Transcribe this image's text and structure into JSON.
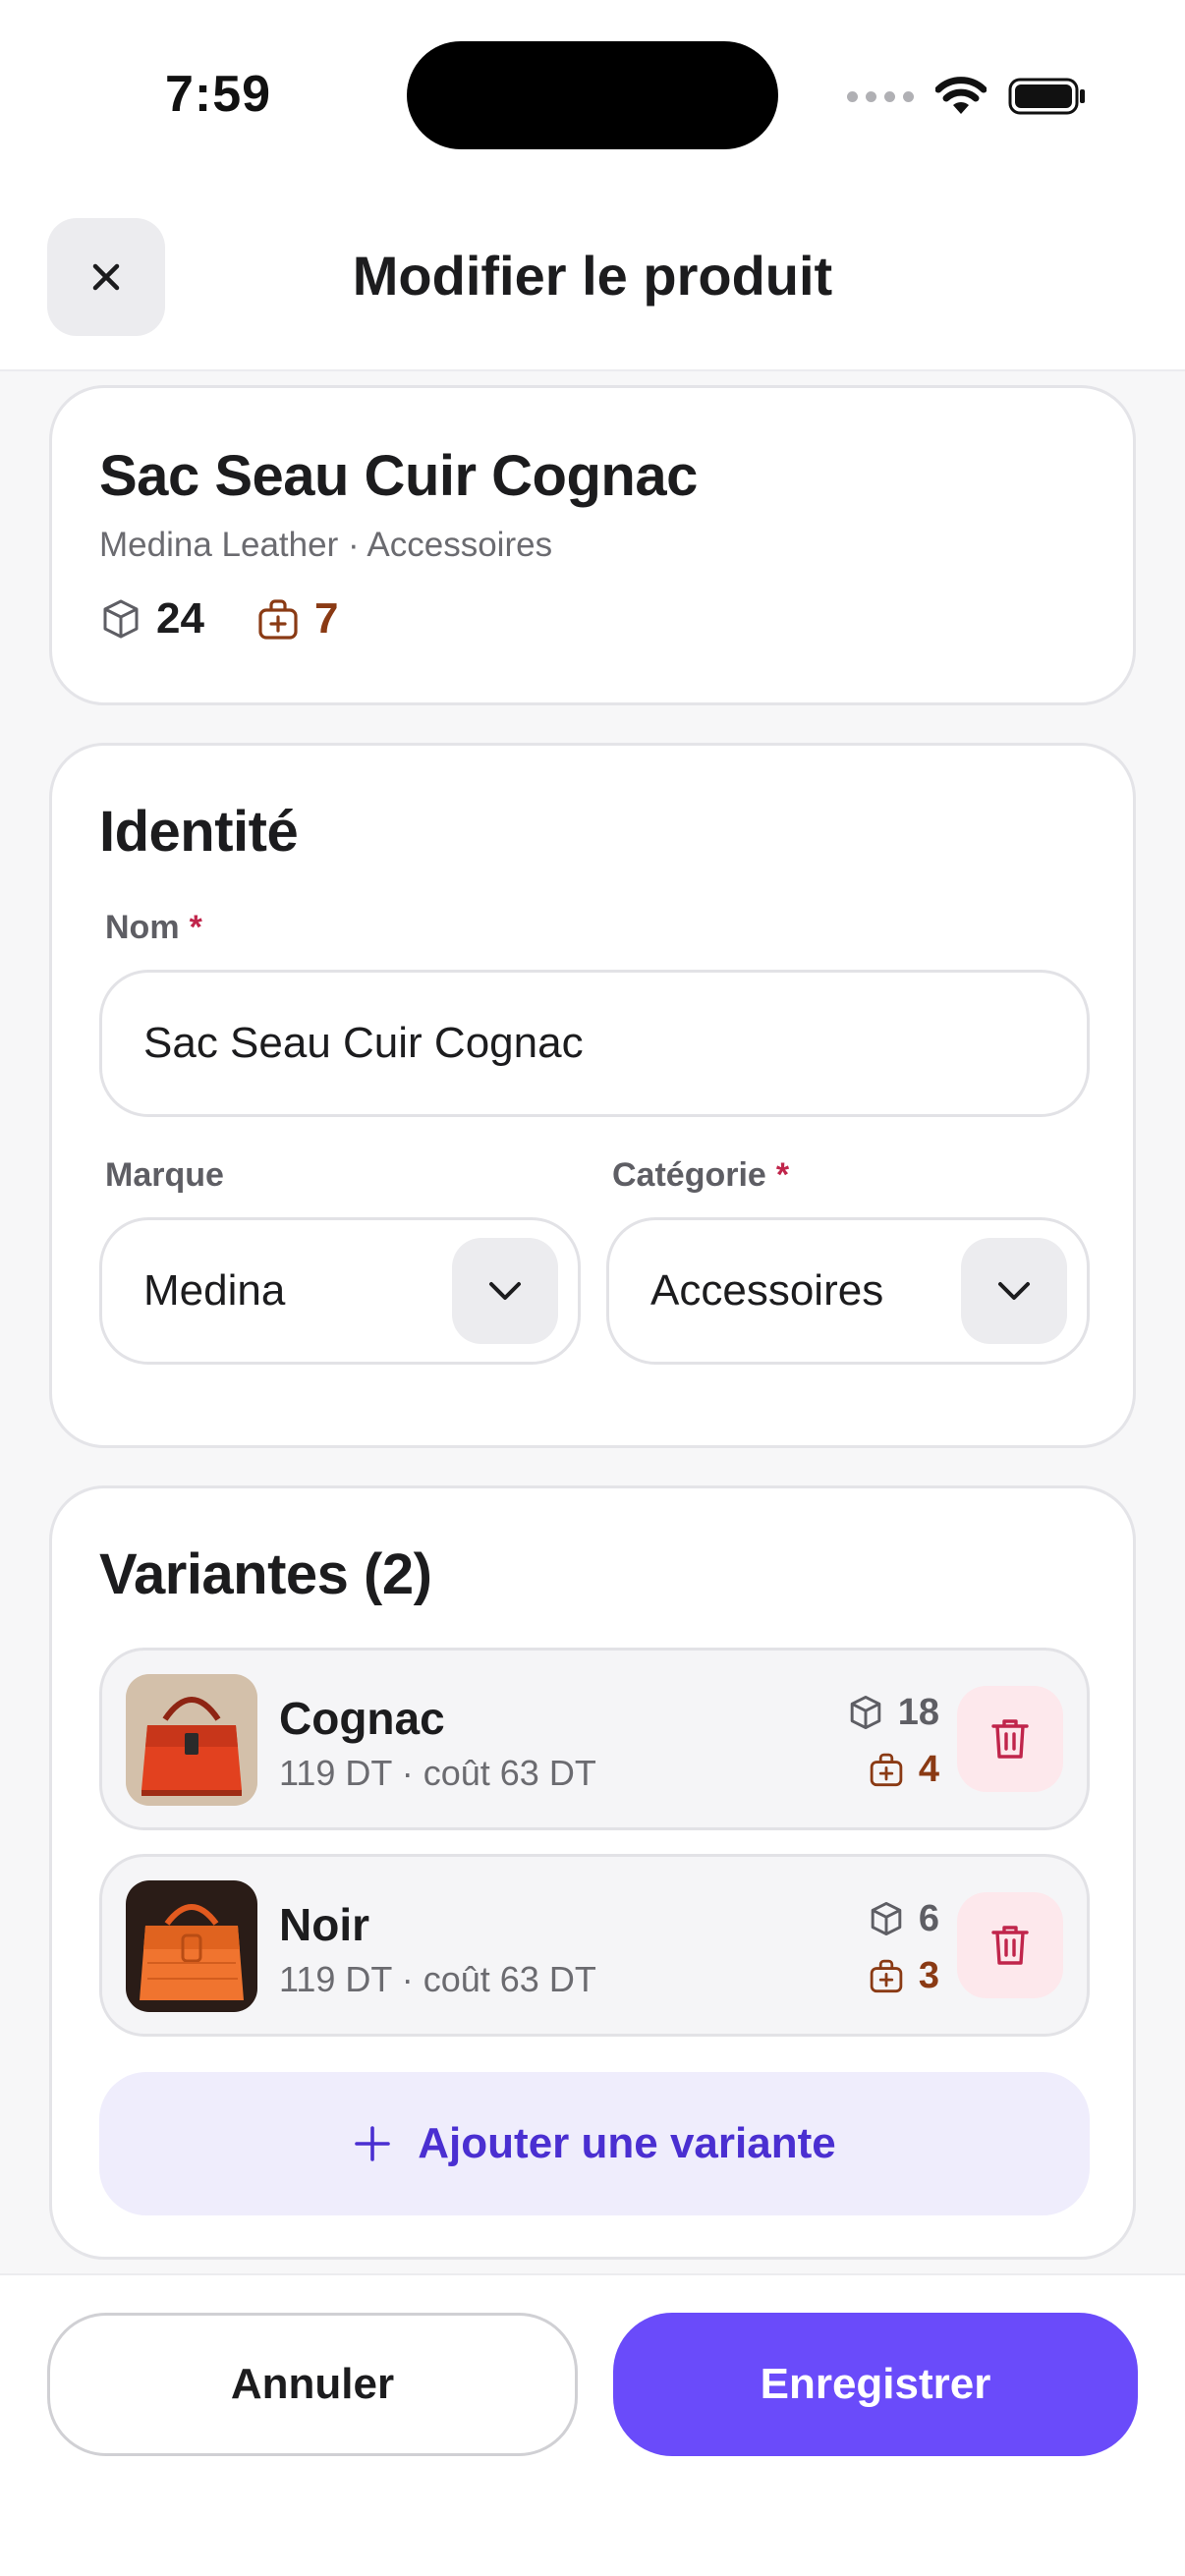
{
  "status_bar": {
    "time": "7:59"
  },
  "header": {
    "title": "Modifier le produit"
  },
  "summary": {
    "name": "Sac Seau Cuir Cognac",
    "subtitle": "Medina Leather · Accessoires",
    "stock": "24",
    "retail": "7"
  },
  "identity": {
    "title": "Identité",
    "name_label": "Nom",
    "required_mark": "*",
    "name_value": "Sac Seau Cuir Cognac",
    "brand_label": "Marque",
    "brand_value": "Medina",
    "category_label": "Catégorie",
    "category_value": "Accessoires"
  },
  "variants": {
    "title": "Variantes (2)",
    "items": [
      {
        "name": "Cognac",
        "details": "119 DT · coût 63 DT",
        "stock": "18",
        "retail": "4"
      },
      {
        "name": "Noir",
        "details": "119 DT · coût 63 DT",
        "stock": "6",
        "retail": "3"
      }
    ],
    "add_label": "Ajouter une variante"
  },
  "footer": {
    "cancel_label": "Annuler",
    "save_label": "Enregistrer"
  },
  "colors": {
    "accent": "#6a4bfa",
    "retail": "#8a3a14",
    "danger": "#c0254b"
  }
}
